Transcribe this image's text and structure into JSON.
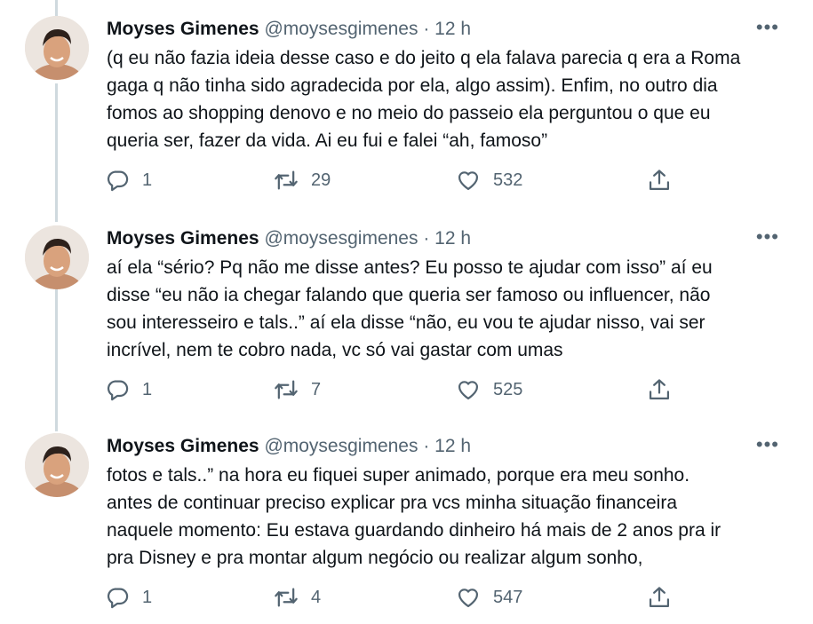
{
  "tweets": [
    {
      "author_name": "Moyses Gimenes",
      "handle": "@moysesgimenes",
      "separator": "·",
      "time": "12 h",
      "more": "•••",
      "text": "(q eu não fazia ideia desse caso e do jeito q ela falava parecia q era a Roma\ngaga q não tinha sido agradecida por ela, algo assim). Enfim, no outro dia\nfomos ao shopping denovo e no meio do passeio ela perguntou o que eu\nqueria ser, fazer da vida. Ai eu fui e falei “ah, famoso”",
      "replies": "1",
      "retweets": "29",
      "likes": "532"
    },
    {
      "author_name": "Moyses Gimenes",
      "handle": "@moysesgimenes",
      "separator": "·",
      "time": "12 h",
      "more": "•••",
      "text": "aí ela “sério? Pq não me disse antes? Eu posso te ajudar com isso” aí eu\ndisse “eu não ia chegar falando que queria ser famoso ou influencer, não\nsou interesseiro e tals..” aí ela disse “não, eu vou te ajudar nisso, vai ser\nincrível, nem te cobro nada, vc só vai gastar com umas",
      "replies": "1",
      "retweets": "7",
      "likes": "525"
    },
    {
      "author_name": "Moyses Gimenes",
      "handle": "@moysesgimenes",
      "separator": "·",
      "time": "12 h",
      "more": "•••",
      "text": "fotos e tals..” na hora eu fiquei super animado, porque era meu sonho.\nantes de continuar preciso explicar pra vcs minha situação financeira\nnaquele momento: Eu estava guardando dinheiro há mais de 2 anos pra ir\npra Disney e pra montar algum negócio ou realizar algum sonho,",
      "replies": "1",
      "retweets": "4",
      "likes": "547"
    }
  ],
  "icons": {
    "reply": "reply-icon",
    "retweet": "retweet-icon",
    "like": "heart-icon",
    "share": "share-icon"
  },
  "colors": {
    "text": "#0f1419",
    "secondary": "#536471",
    "thread_line": "#cfd9de",
    "background": "#ffffff"
  }
}
